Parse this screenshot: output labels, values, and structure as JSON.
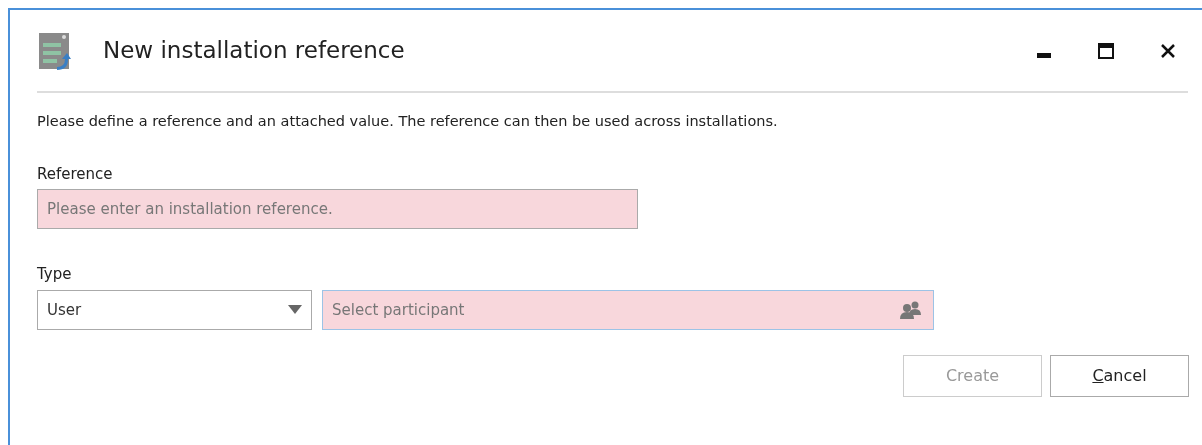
{
  "window": {
    "title": "New installation reference"
  },
  "description": "Please define a reference and an attached value. The reference can then be used across installations.",
  "reference": {
    "label": "Reference",
    "placeholder": "Please enter an installation reference.",
    "invalid": true
  },
  "type": {
    "label": "Type",
    "value": "User"
  },
  "participant": {
    "placeholder": "Select participant",
    "invalid": true
  },
  "buttons": [
    {
      "label": "Create",
      "disabled": true
    },
    {
      "label": "Cancel",
      "disabled": false,
      "access_key_underlined": true
    }
  ]
}
